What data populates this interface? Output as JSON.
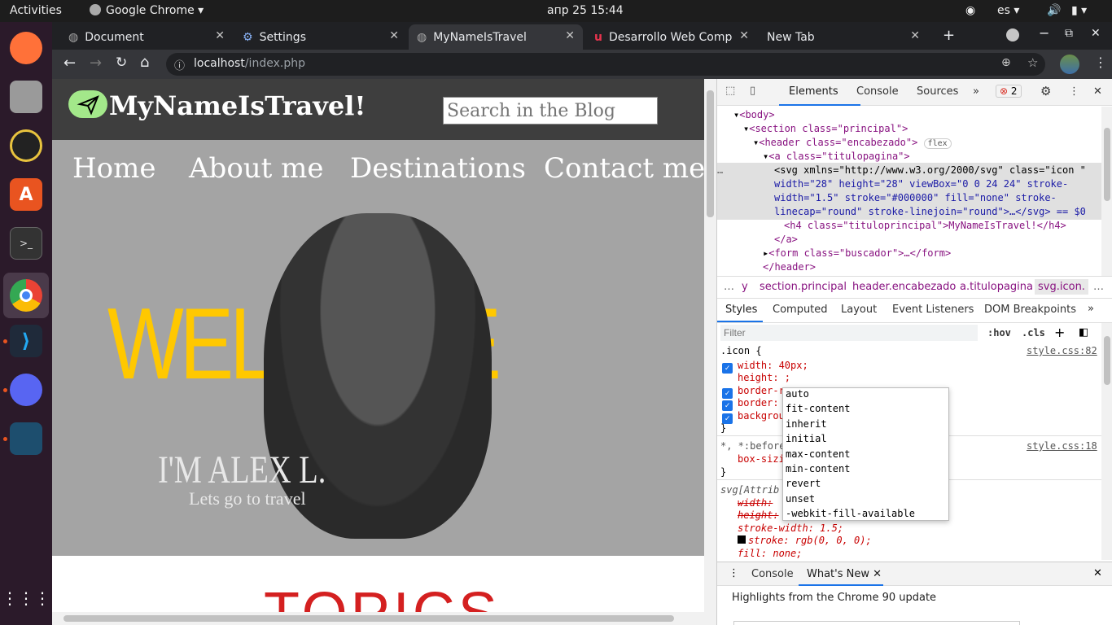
{
  "system": {
    "activities": "Activities",
    "app": "Google Chrome",
    "datetime": "апр 25  15:44",
    "lang": "es"
  },
  "tabs": [
    {
      "label": "Document"
    },
    {
      "label": "Settings"
    },
    {
      "label": "MyNameIsTravel"
    },
    {
      "label": "Desarrollo Web Comp"
    },
    {
      "label": "New Tab"
    }
  ],
  "address": {
    "host": "localhost",
    "path": "/index.php"
  },
  "site": {
    "title": "MyNameIsTravel!",
    "search_placeholder": "Search in the Blog",
    "nav": [
      "Home",
      "About me",
      "Destinations",
      "Contact me"
    ],
    "welcome": "WELCOME",
    "name": "I'M ALEX L.",
    "tagline": "Lets go to travel",
    "topics": "TOPICS"
  },
  "devtools": {
    "tabs": [
      "Elements",
      "Console",
      "Sources"
    ],
    "error_count": "2",
    "dom": {
      "body": "<body>",
      "section": "<section class=\"principal\">",
      "header": "<header class=\"encabezado\">",
      "flex": "flex",
      "a": "<a class=\"titulopagina\">",
      "svg1": "<svg xmlns=\"http://www.w3.org/2000/svg\" class=\"icon \"",
      "svg2": "width=\"28\" height=\"28\" viewBox=\"0 0 24 24\" stroke-",
      "svg3": "width=\"1.5\" stroke=\"#000000\" fill=\"none\" stroke-",
      "svg4": "linecap=\"round\" stroke-linejoin=\"round\">…</svg> == $0",
      "h4": "<h4 class=\"tituloprincipal\">MyNameIsTravel!</h4>",
      "a_close": "</a>",
      "form": "<form class=\"buscador\">…</form>",
      "header_close": "</header>"
    },
    "breadcrumbs": [
      "y",
      "section.principal",
      "header.encabezado",
      "a.titulopagina",
      "svg.icon."
    ],
    "style_tabs": [
      "Styles",
      "Computed",
      "Layout",
      "Event Listeners",
      "DOM Breakpoints"
    ],
    "filter_placeholder": "Filter",
    "hov": ":hov",
    "cls": ".cls",
    "rule1": {
      "selector": ".icon {",
      "source": "style.css:82"
    },
    "props1": [
      "width: 40px;",
      "height: ;",
      "border-r",
      "border: ",
      "backgrou"
    ],
    "close_brace": "}",
    "rule2": {
      "selector": "*, *:before",
      "source": "style.css:18",
      "prop": "box-sizi"
    },
    "rule3": {
      "selector": "svg[Attrib",
      "props": [
        "width: ",
        "height: ",
        "stroke-width: 1.5;",
        "stroke: rgb(0, 0, 0);",
        "fill: none;"
      ]
    },
    "autocomplete": [
      "auto",
      "fit-content",
      "inherit",
      "initial",
      "max-content",
      "min-content",
      "revert",
      "unset",
      "-webkit-fill-available"
    ],
    "drawer": {
      "console": "Console",
      "whatsnew": "What's New",
      "highlights": "Highlights from the Chrome 90 update"
    }
  }
}
